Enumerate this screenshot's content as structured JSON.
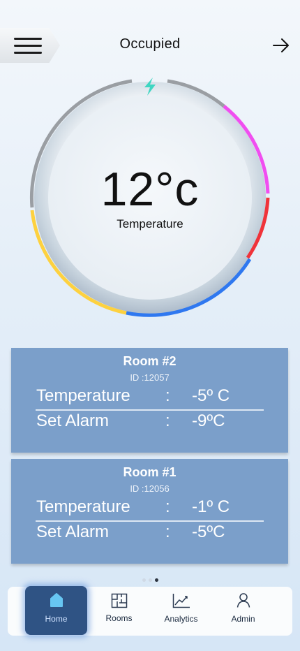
{
  "header": {
    "title": "Occupied"
  },
  "gauge": {
    "value": "12°c",
    "label": "Temperature"
  },
  "rooms": [
    {
      "name": "Room #2",
      "id": "ID :12057",
      "rows": [
        {
          "key": "Temperature",
          "sep": ":",
          "value": "-5º C"
        },
        {
          "key": "Set Alarm",
          "sep": ":",
          "value": "-9ºC"
        }
      ]
    },
    {
      "name": "Room #1",
      "id": "ID :12056",
      "rows": [
        {
          "key": "Temperature",
          "sep": ":",
          "value": "-1º C"
        },
        {
          "key": "Set Alarm",
          "sep": ":",
          "value": "-5ºC"
        }
      ]
    }
  ],
  "pager": {
    "count": 3,
    "active": 2
  },
  "nav": {
    "items": [
      {
        "label": "Home",
        "icon": "home-icon",
        "active": true
      },
      {
        "label": "Rooms",
        "icon": "floorplan-icon",
        "active": false
      },
      {
        "label": "Analytics",
        "icon": "chart-icon",
        "active": false
      },
      {
        "label": "Admin",
        "icon": "user-icon",
        "active": false
      }
    ]
  },
  "colors": {
    "card": "#7b9fca",
    "nav_active": "#2f5384",
    "gauge_gray": "#9a9ea3",
    "gauge_magenta": "#f04ef0",
    "gauge_red": "#f0333a",
    "gauge_blue": "#2f78f0",
    "gauge_yellow": "#fdd13f",
    "bolt": "#3fd6c2"
  }
}
